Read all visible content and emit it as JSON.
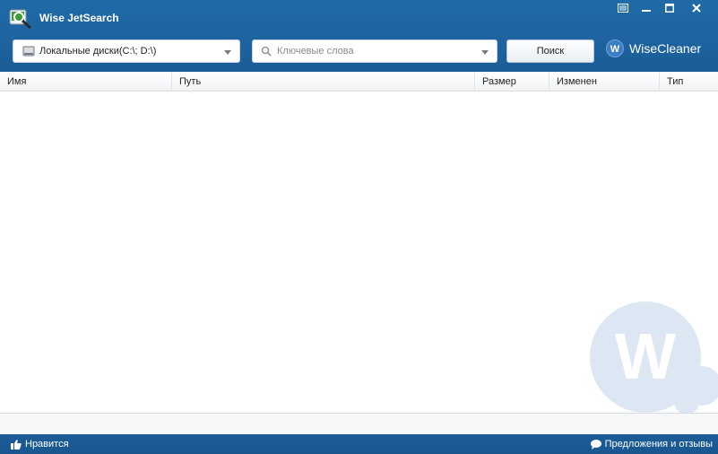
{
  "app": {
    "title": "Wise JetSearch",
    "icon": "magnifier-drive-icon"
  },
  "window_controls": [
    {
      "name": "menu-icon"
    },
    {
      "name": "minimize-icon"
    },
    {
      "name": "maximize-icon"
    },
    {
      "name": "close-icon"
    }
  ],
  "toolbar": {
    "drive_select_value": "Локальные диски(C:\\; D:\\)",
    "search_placeholder": "Ключевые слова",
    "search_button": "Поиск",
    "brand": "WiseCleaner"
  },
  "table": {
    "columns": [
      "Имя",
      "Путь",
      "Размер",
      "Изменен",
      "Тип"
    ],
    "rows": []
  },
  "footer": {
    "like": "Нравится",
    "feedback": "Предложения и отзывы"
  },
  "colors": {
    "titlebar": "#1d64a0",
    "footer": "#1b5d97",
    "watermark": "#dbe6f3"
  }
}
